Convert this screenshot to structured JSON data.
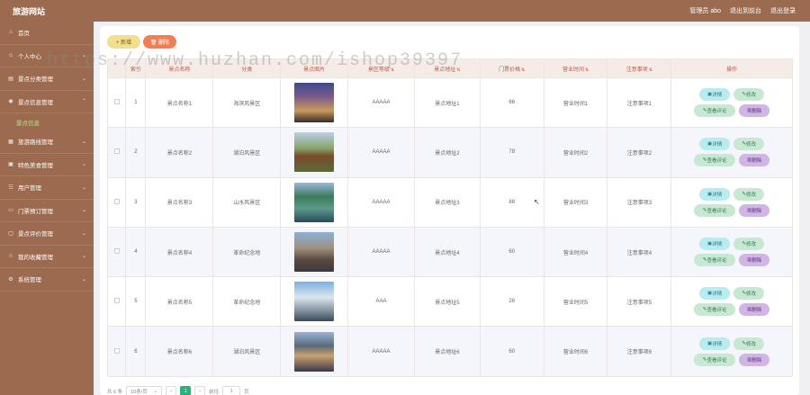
{
  "header": {
    "brand": "旅游网站",
    "user": "管理员 abo",
    "front": "退出到前台",
    "logout": "退出登录"
  },
  "sidebar": {
    "items": [
      {
        "label": "首页"
      },
      {
        "label": "个人中心"
      },
      {
        "label": "景点分类管理"
      },
      {
        "label": "景点信息管理"
      },
      {
        "label": "旅游路线管理"
      },
      {
        "label": "特色美食管理"
      },
      {
        "label": "用户管理"
      },
      {
        "label": "门票预订管理"
      },
      {
        "label": "景点评价管理"
      },
      {
        "label": "我的收藏管理"
      },
      {
        "label": "系统管理"
      }
    ],
    "active_sub": "景点信息"
  },
  "toolbar": {
    "add": "+ 新增",
    "delete": "🗑 删除"
  },
  "table": {
    "headers": [
      "索引",
      "景点名称",
      "分类",
      "景点图片",
      "景区等级",
      "景点地址",
      "门票价格",
      "营业时间",
      "注意事项",
      "操作"
    ],
    "rows": [
      {
        "index": "1",
        "name": "景点名称1",
        "category": "海滨风景区",
        "level": "AAAAA",
        "address": "景点地址1",
        "price": "66",
        "hours": "营业时间1",
        "notes": "注意事项1"
      },
      {
        "index": "2",
        "name": "景点名称2",
        "category": "湖泊风景区",
        "level": "AAAAA",
        "address": "景点地址2",
        "price": "78",
        "hours": "营业时间2",
        "notes": "注意事项2"
      },
      {
        "index": "3",
        "name": "景点名称3",
        "category": "山水风景区",
        "level": "AAAAA",
        "address": "景点地址3",
        "price": "88",
        "hours": "营业时间3",
        "notes": "注意事项3"
      },
      {
        "index": "4",
        "name": "景点名称4",
        "category": "革命纪念地",
        "level": "AAAAA",
        "address": "景点地址4",
        "price": "60",
        "hours": "营业时间4",
        "notes": "注意事项4"
      },
      {
        "index": "5",
        "name": "景点名称5",
        "category": "革命纪念地",
        "level": "AAA",
        "address": "景点地址5",
        "price": "26",
        "hours": "营业时间5",
        "notes": "注意事项5"
      },
      {
        "index": "6",
        "name": "景点名称6",
        "category": "湖泊风景区",
        "level": "AAAAA",
        "address": "景点地址6",
        "price": "60",
        "hours": "营业时间6",
        "notes": "注意事项6"
      }
    ],
    "ops": {
      "detail": "详情",
      "edit": "修改",
      "review": "查看评论",
      "delete": "删除"
    }
  },
  "pagination": {
    "total": "共 6 条",
    "page_size": "10条/页",
    "current": "1",
    "goto_label": "前往",
    "goto_value": "1",
    "page_unit": "页"
  },
  "watermark": "https://www.huzhan.com/ishop39397",
  "colors": {
    "sidebar": "#9b6a4f",
    "header_text": "#b5584a",
    "active_page": "#2ab27a"
  }
}
